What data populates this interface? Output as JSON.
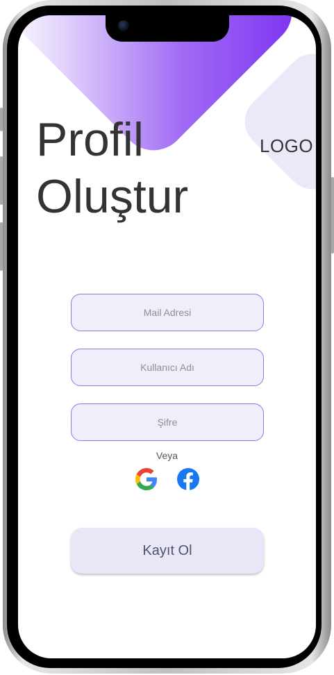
{
  "header": {
    "title_line1": "Profil",
    "title_line2": "Oluştur",
    "logo": "LOGO"
  },
  "form": {
    "email_placeholder": "Mail Adresi",
    "username_placeholder": "Kullanıcı Adı",
    "password_placeholder": "Şifre"
  },
  "divider_text": "Veya",
  "social": {
    "google_icon": "google-icon",
    "facebook_icon": "facebook-icon"
  },
  "actions": {
    "register_label": "Kayıt Ol"
  },
  "colors": {
    "accent": "#7b2ff0",
    "field_border": "#9d6ee8",
    "field_bg": "#f0eef8",
    "button_bg": "#e9e6f7",
    "facebook_blue": "#1877f2"
  }
}
